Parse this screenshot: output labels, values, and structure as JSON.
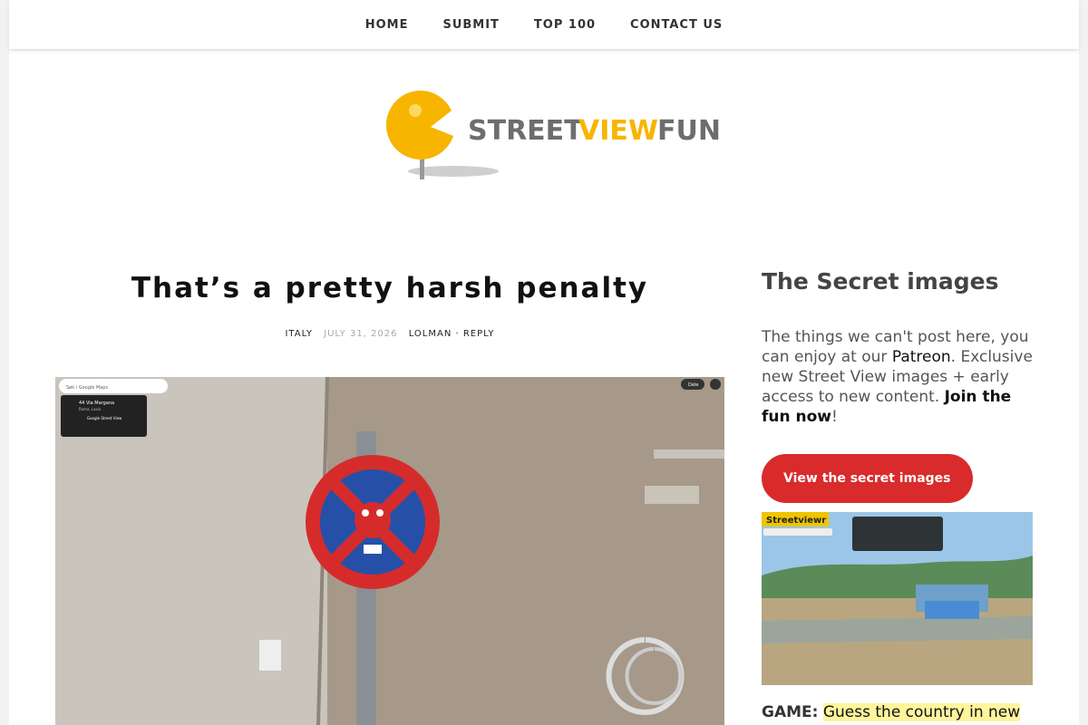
{
  "nav": {
    "items": [
      "HOME",
      "SUBMIT",
      "TOP 100",
      "CONTACT US"
    ]
  },
  "logo": {
    "text": "STREETVIEWFUN"
  },
  "post": {
    "title": "That’s a pretty harsh penalty",
    "category": "ITALY",
    "date": "JULY 31, 2026",
    "author": "LOLMAN",
    "separator": "·",
    "reply": "REPLY",
    "image": {
      "search_placeholder": "Søk i Google Maps",
      "place_name": "44 Via Margana",
      "place_sub": "Roma, Lazio",
      "sv_label": "Google Street View",
      "share": "Dele"
    }
  },
  "sidebar": {
    "title": "The Secret images",
    "text_before": "The things we can't post here, you can enjoy at our ",
    "patreon": "Patreon",
    "text_after": ". Exclusive new Street View images + early access to new content. ",
    "join": "Join the fun now",
    "excl": "!",
    "button": "View the secret images",
    "thumb_label": "Streetviewr",
    "game_label": "GAME:",
    "game_text": "Guess the country in new"
  },
  "colors": {
    "accent_red": "#d92b2b",
    "logo_yellow": "#f7b500",
    "logo_gray": "#6d6d6d",
    "highlight": "#fff59d"
  }
}
